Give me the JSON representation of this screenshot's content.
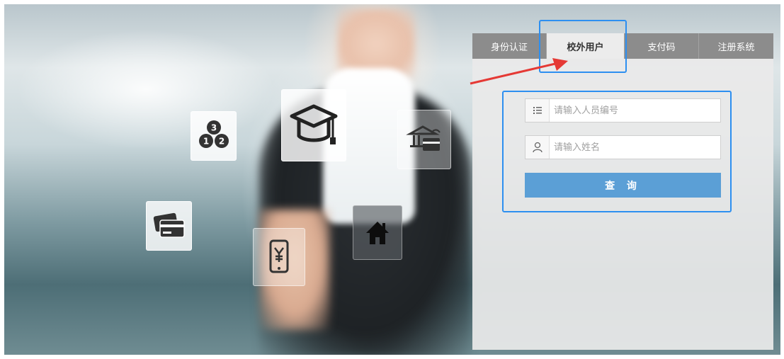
{
  "tabs": [
    {
      "label": "身份认证",
      "active": false
    },
    {
      "label": "校外用户",
      "active": true
    },
    {
      "label": "支付码",
      "active": false
    },
    {
      "label": "注册系统",
      "active": false
    }
  ],
  "form": {
    "person_id_placeholder": "请输入人员编号",
    "name_placeholder": "请输入姓名",
    "submit_label": "查 询"
  },
  "icons": {
    "tiles": [
      "number-balls-icon",
      "graduation-cap-icon",
      "bank-card-icon",
      "credit-card-icon",
      "mobile-payment-icon",
      "home-icon"
    ],
    "fields": [
      "list-icon",
      "user-icon"
    ]
  },
  "badges": {
    "ball_1": "1",
    "ball_2": "2",
    "ball_3": "3"
  },
  "colors": {
    "button": "#5b9fd6",
    "tab_inactive": "#8c8c8c",
    "tab_active": "#ececec",
    "highlight": "#2d8ff0",
    "arrow": "#e53935"
  }
}
